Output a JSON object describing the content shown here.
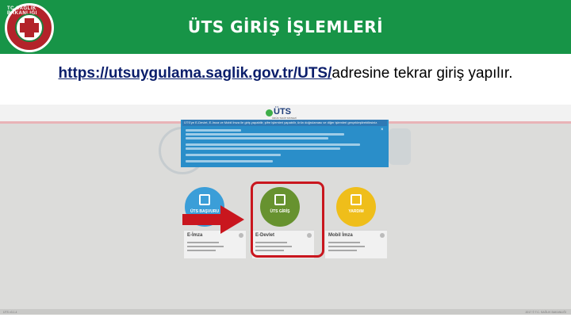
{
  "slide": {
    "title": "ÜTS GİRİŞ İŞLEMLERİ",
    "instruction_url": "https://utsuygulama.saglik.gov.tr/UTS/",
    "instruction_rest": "adresine tekrar giriş yapılır.",
    "logo_text": "TC SAĞLIK BAKANLIĞI"
  },
  "app": {
    "logo_name": "ÜTS",
    "logo_subtitle": "ÜRÜN TAKİP SİSTEMİ",
    "popup_header": "ÜTS'ye E-Devlet, E-İmza ve Mobil İmza ile giriş yapabilir, şifre işlemleri yapabilir, ürün doğrulaması ve diğer işlemleri gerçekleştirebilirsiniz.",
    "popup_close": "×",
    "actions": [
      {
        "label": "ÜTS BAŞVURU",
        "color": "#3b9ed8"
      },
      {
        "label": "ÜTS GİRİŞ",
        "color": "#67922f"
      },
      {
        "label": "YARDIM",
        "color": "#efbe1a"
      }
    ],
    "cards": [
      {
        "title": "E-İmza",
        "info": "?"
      },
      {
        "title": "E-Devlet",
        "info": "?"
      },
      {
        "title": "Mobil İmza",
        "info": "?"
      }
    ],
    "footer_left": "ÜTS v3.1.4",
    "footer_right": "2017 © T.C. SAĞLIK BAKANLIĞI"
  },
  "colors": {
    "header_green": "#179447",
    "highlight_red": "#c9161e",
    "link_blue": "#0b1e6b"
  }
}
